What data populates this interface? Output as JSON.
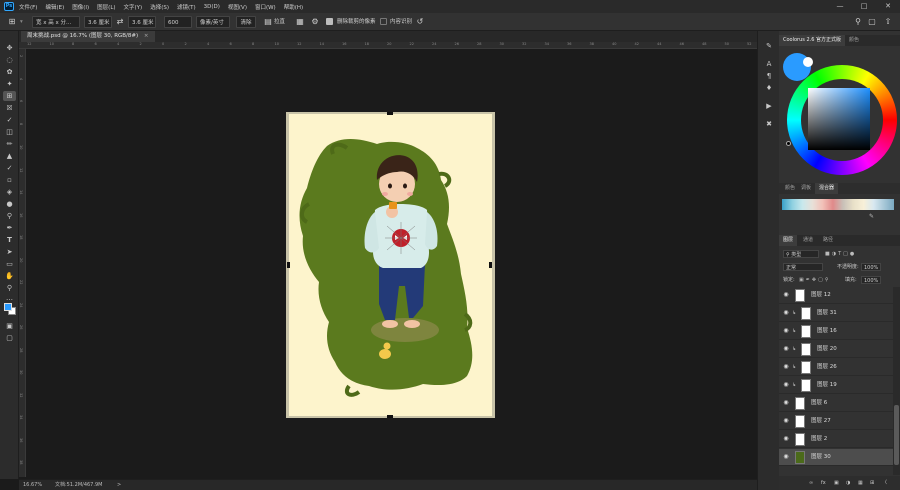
{
  "menubar": {
    "items": [
      "文件(F)",
      "编辑(E)",
      "图像(I)",
      "图层(L)",
      "文字(Y)",
      "选择(S)",
      "滤镜(T)",
      "3D(D)",
      "视图(V)",
      "窗口(W)",
      "帮助(H)"
    ]
  },
  "options_bar": {
    "ratio_preset": "宽 x 高 x 分...",
    "width_value": "3.6 厘米",
    "height_value": "3.6 厘米",
    "resolution_value": "600",
    "resolution_unit": "像素/英寸",
    "clear_label": "清除",
    "straighten_label": "拉直",
    "delete_cropped_label": "删除裁剪的像素",
    "content_aware_label": "内容识别"
  },
  "document": {
    "tab_title": "周末挑战.psd @ 16.7% (图层 30, RGB/8#)",
    "close_glyph": "×"
  },
  "ruler": {
    "top_ticks": [
      "12",
      "10",
      "8",
      "6",
      "4",
      "2",
      "0",
      "2",
      "4",
      "6",
      "8",
      "10",
      "12",
      "14",
      "16",
      "18",
      "20",
      "22",
      "24",
      "26",
      "28",
      "30",
      "32",
      "34",
      "36",
      "38",
      "40",
      "42",
      "44",
      "46",
      "48",
      "50",
      "52"
    ],
    "left_ticks": [
      "2",
      "4",
      "6",
      "8",
      "10",
      "12",
      "14",
      "16",
      "18",
      "20",
      "22",
      "24",
      "26",
      "28",
      "30",
      "32",
      "34",
      "36",
      "38"
    ]
  },
  "status_bar": {
    "zoom": "16.67%",
    "doc_size": "文档:51.2M/467.9M",
    "arrow": ">"
  },
  "color_panel": {
    "tab_active": "Coolorus 2.6 官方正式版",
    "tab_other": "颜色",
    "subtabs": [
      "颜色",
      "调板",
      "混合器"
    ],
    "foreground_color": "#2a9bff"
  },
  "layers_panel": {
    "tabs": [
      "图层",
      "通道",
      "路径"
    ],
    "filter_kind": "类型",
    "blend_mode": "正常",
    "opacity_label": "不透明度:",
    "opacity_value": "100%",
    "lock_label": "锁定:",
    "fill_label": "填充:",
    "fill_value": "100%",
    "layers": [
      {
        "name": "图层 12",
        "clipped": false,
        "selected": false
      },
      {
        "name": "图层 31",
        "clipped": true,
        "selected": false
      },
      {
        "name": "图层 16",
        "clipped": true,
        "selected": false
      },
      {
        "name": "图层 20",
        "clipped": true,
        "selected": false
      },
      {
        "name": "图层 26",
        "clipped": true,
        "selected": false
      },
      {
        "name": "图层 19",
        "clipped": true,
        "selected": false
      },
      {
        "name": "图层 6",
        "clipped": false,
        "selected": false
      },
      {
        "name": "图层 27",
        "clipped": false,
        "selected": false
      },
      {
        "name": "图层 2",
        "clipped": false,
        "selected": false
      },
      {
        "name": "图层 30",
        "clipped": false,
        "selected": true
      }
    ],
    "footer_icons": [
      "link-icon",
      "fx-icon",
      "mask-icon",
      "adjustment-icon",
      "group-icon",
      "new-layer-icon",
      "delete-icon"
    ]
  },
  "colors": {
    "accent": "#31a8ff",
    "grass": "#5b7a1e",
    "paper": "#fdf4cc"
  }
}
